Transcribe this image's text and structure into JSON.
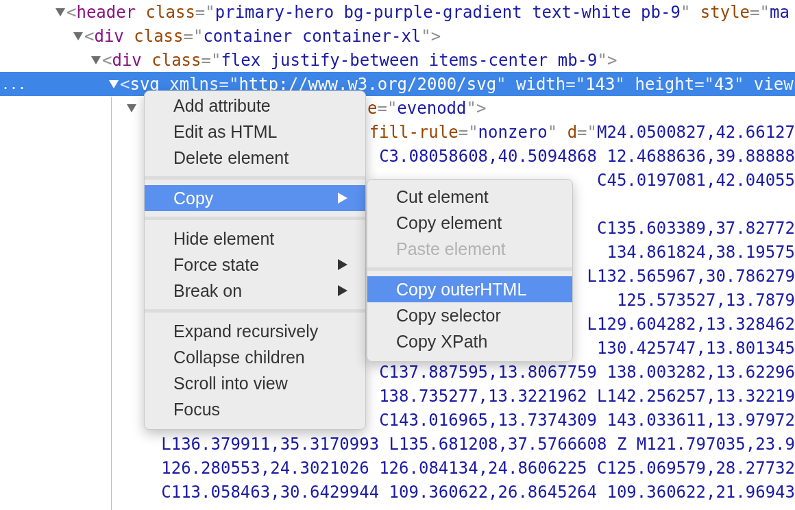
{
  "dom_tree": [
    {
      "expanded": true,
      "selected": false,
      "tokens": [
        {
          "kind": "punct",
          "text": "<"
        },
        {
          "kind": "tag",
          "text": "header"
        },
        {
          "kind": "attr",
          "text": " class"
        },
        {
          "kind": "punct",
          "text": "=\""
        },
        {
          "kind": "value",
          "text": "primary-hero bg-purple-gradient text-white pb-9"
        },
        {
          "kind": "punct",
          "text": "\""
        },
        {
          "kind": "attr",
          "text": " style"
        },
        {
          "kind": "punct",
          "text": "=\""
        },
        {
          "kind": "value",
          "text": "ma"
        }
      ],
      "children": [
        {
          "expanded": true,
          "selected": false,
          "tokens": [
            {
              "kind": "punct",
              "text": "<"
            },
            {
              "kind": "tag",
              "text": "div"
            },
            {
              "kind": "attr",
              "text": " class"
            },
            {
              "kind": "punct",
              "text": "=\""
            },
            {
              "kind": "value",
              "text": "container container-xl"
            },
            {
              "kind": "punct",
              "text": "\">"
            }
          ],
          "children": [
            {
              "expanded": true,
              "selected": false,
              "tokens": [
                {
                  "kind": "punct",
                  "text": "<"
                },
                {
                  "kind": "tag",
                  "text": "div"
                },
                {
                  "kind": "attr",
                  "text": " class"
                },
                {
                  "kind": "punct",
                  "text": "=\""
                },
                {
                  "kind": "value",
                  "text": "flex justify-between items-center mb-9"
                },
                {
                  "kind": "punct",
                  "text": "\">"
                }
              ],
              "children": [
                {
                  "expanded": true,
                  "selected": true,
                  "gutter_mark": "...",
                  "tokens": [
                    {
                      "kind": "punct",
                      "text": "<"
                    },
                    {
                      "kind": "tag",
                      "text": "svg"
                    },
                    {
                      "kind": "attr",
                      "text": " xmlns"
                    },
                    {
                      "kind": "punct",
                      "text": "=\""
                    },
                    {
                      "kind": "value",
                      "text": "http://www.w3.org/2000/svg"
                    },
                    {
                      "kind": "punct",
                      "text": "\""
                    },
                    {
                      "kind": "attr",
                      "text": " width"
                    },
                    {
                      "kind": "punct",
                      "text": "=\""
                    },
                    {
                      "kind": "value",
                      "text": "143"
                    },
                    {
                      "kind": "punct",
                      "text": "\""
                    },
                    {
                      "kind": "attr",
                      "text": " height"
                    },
                    {
                      "kind": "punct",
                      "text": "=\""
                    },
                    {
                      "kind": "value",
                      "text": "43"
                    },
                    {
                      "kind": "punct",
                      "text": "\""
                    },
                    {
                      "kind": "attr",
                      "text": " view"
                    }
                  ],
                  "children": [
                    {
                      "expanded": true,
                      "selected": false,
                      "partial": true,
                      "tokens": [
                        {
                          "kind": "attr",
                          "text": "e"
                        },
                        {
                          "kind": "punct",
                          "text": "=\""
                        },
                        {
                          "kind": "value",
                          "text": "evenodd"
                        },
                        {
                          "kind": "punct",
                          "text": "\">"
                        }
                      ]
                    }
                  ]
                }
              ]
            }
          ]
        }
      ]
    }
  ],
  "path_lines": [
    {
      "tokens": [
        {
          "kind": "attr",
          "text": "fill-rule"
        },
        {
          "kind": "punct",
          "text": "=\""
        },
        {
          "kind": "value",
          "text": "nonzero"
        },
        {
          "kind": "punct",
          "text": "\""
        },
        {
          "kind": "attr",
          "text": " d"
        },
        {
          "kind": "punct",
          "text": "=\""
        },
        {
          "kind": "value",
          "text": "M24.0500827,42.66127"
        }
      ]
    },
    {
      "tokens": [
        {
          "kind": "value",
          "text": "C3.08058608,40.5094868 12.4688636,39.88888"
        }
      ]
    },
    {
      "tokens": [
        {
          "kind": "value",
          "text": "C45.0197081,42.04055"
        }
      ]
    },
    {
      "tokens": [
        {
          "kind": "value",
          "text": "C135.603389,37.82772"
        }
      ]
    },
    {
      "tokens": [
        {
          "kind": "value",
          "text": "134.861824,38.19575"
        }
      ]
    },
    {
      "tokens": [
        {
          "kind": "value",
          "text": "L132.565967,30.786279"
        }
      ]
    },
    {
      "tokens": [
        {
          "kind": "value",
          "text": "125.573527,13.7879"
        }
      ]
    },
    {
      "tokens": [
        {
          "kind": "value",
          "text": "L129.604282,13.328462"
        }
      ]
    },
    {
      "tokens": [
        {
          "kind": "value",
          "text": "130.425747,13.801345"
        }
      ]
    },
    {
      "tokens": [
        {
          "kind": "value",
          "text": "C137.887595,13.8067759 138.003282,13.62296"
        }
      ]
    },
    {
      "tokens": [
        {
          "kind": "value",
          "text": "138.735277,13.3221962 L142.256257,13.32219"
        }
      ]
    },
    {
      "tokens": [
        {
          "kind": "value",
          "text": "C143.016965,13.7374309 143.033611,13.97972"
        }
      ]
    },
    {
      "tokens": [
        {
          "kind": "value",
          "text": "L136.379911,35.3170993 L135.681208,37.5766608 Z M121.797035,23.9"
        }
      ]
    },
    {
      "tokens": [
        {
          "kind": "value",
          "text": "126.280553,24.3021026 126.084134,24.8606225 C125.069579,28.27732"
        }
      ]
    },
    {
      "tokens": [
        {
          "kind": "value",
          "text": "C113.058463,30.6429944 109.360622,26.8645264 109.360622,21.96943"
        }
      ]
    }
  ],
  "context_menu": {
    "groups": [
      [
        {
          "label": "Add attribute",
          "selected": false,
          "disabled": false,
          "submenu": false
        },
        {
          "label": "Edit as HTML",
          "selected": false,
          "disabled": false,
          "submenu": false
        },
        {
          "label": "Delete element",
          "selected": false,
          "disabled": false,
          "submenu": false
        }
      ],
      [
        {
          "label": "Copy",
          "selected": true,
          "disabled": false,
          "submenu": true
        }
      ],
      [
        {
          "label": "Hide element",
          "selected": false,
          "disabled": false,
          "submenu": false
        },
        {
          "label": "Force state",
          "selected": false,
          "disabled": false,
          "submenu": true
        },
        {
          "label": "Break on",
          "selected": false,
          "disabled": false,
          "submenu": true
        }
      ],
      [
        {
          "label": "Expand recursively",
          "selected": false,
          "disabled": false,
          "submenu": false
        },
        {
          "label": "Collapse children",
          "selected": false,
          "disabled": false,
          "submenu": false
        },
        {
          "label": "Scroll into view",
          "selected": false,
          "disabled": false,
          "submenu": false
        },
        {
          "label": "Focus",
          "selected": false,
          "disabled": false,
          "submenu": false
        }
      ]
    ]
  },
  "copy_submenu": {
    "groups": [
      [
        {
          "label": "Cut element",
          "selected": false,
          "disabled": false,
          "submenu": false
        },
        {
          "label": "Copy element",
          "selected": false,
          "disabled": false,
          "submenu": false
        },
        {
          "label": "Paste element",
          "selected": false,
          "disabled": true,
          "submenu": false
        }
      ],
      [
        {
          "label": "Copy outerHTML",
          "selected": true,
          "disabled": false,
          "submenu": false
        },
        {
          "label": "Copy selector",
          "selected": false,
          "disabled": false,
          "submenu": false
        },
        {
          "label": "Copy XPath",
          "selected": false,
          "disabled": false,
          "submenu": false
        }
      ]
    ]
  }
}
